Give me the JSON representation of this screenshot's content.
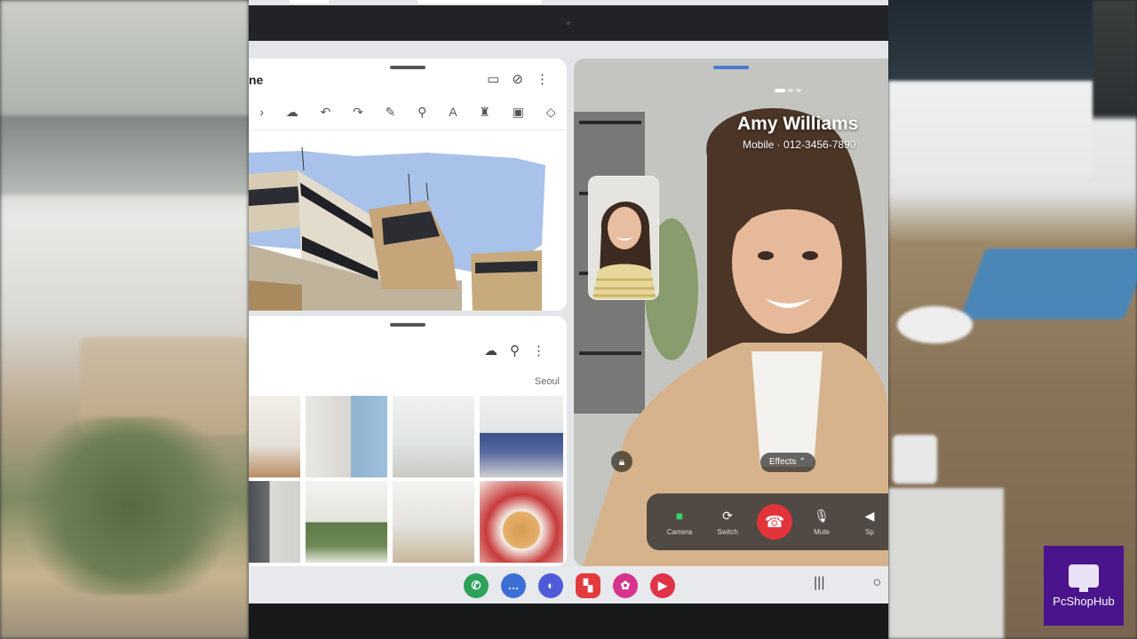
{
  "notes": {
    "title": "ne",
    "header_icons": [
      "book-icon",
      "attach-icon",
      "more-vert-icon"
    ],
    "tool_icons": [
      "pen-icon",
      "cloud-icon",
      "undo-icon",
      "redo-icon",
      "pencil-icon",
      "highlighter-icon",
      "text-icon",
      "brush-icon",
      "image-icon",
      "shape-icon"
    ]
  },
  "gallery": {
    "header_icons": [
      "cloud-icon",
      "search-icon",
      "more-vert-icon"
    ],
    "location": "Seoul"
  },
  "call": {
    "name": "Amy Williams",
    "subtitle": "Mobile · 012-3456-7890",
    "effects_label": "Effects ⌃",
    "controls": [
      {
        "label": "Camera",
        "icon": "camera-icon"
      },
      {
        "label": "Switch",
        "icon": "switch-camera-icon"
      },
      {
        "label": "Mute",
        "icon": "mic-icon"
      },
      {
        "label": "Sp",
        "icon": "speaker-icon"
      }
    ]
  },
  "taskbar": {
    "apps": [
      {
        "name": "phone",
        "color": "#2ea15a",
        "glyph": "✆"
      },
      {
        "name": "messages",
        "color": "#3b6fd6",
        "glyph": "…"
      },
      {
        "name": "internet",
        "color": "#4d5bd8",
        "glyph": "◐"
      },
      {
        "name": "flipboard",
        "color": "#e23a3f",
        "glyph": "▚"
      },
      {
        "name": "gallery",
        "color": "#d6348c",
        "glyph": "✿"
      },
      {
        "name": "youtube",
        "color": "#e0334a",
        "glyph": "▶"
      }
    ],
    "nav": [
      "|||",
      "○"
    ]
  },
  "brand": {
    "text": "PcShopHub"
  },
  "colors": {
    "end_call": "#e2333a",
    "brand_bg": "#4a148c",
    "accent": "#4a7bd0"
  }
}
